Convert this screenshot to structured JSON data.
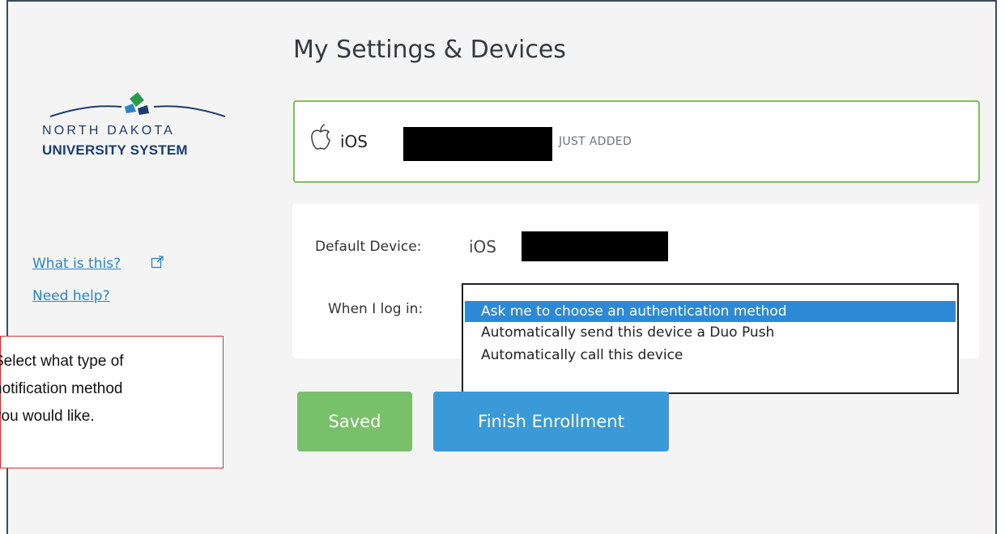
{
  "brand": {
    "line1": "NORTH DAKOTA",
    "line2": "UNIVERSITY SYSTEM"
  },
  "sidebar": {
    "what_is_this": "What is this?",
    "need_help": "Need help?"
  },
  "page": {
    "title": "My Settings & Devices"
  },
  "device": {
    "os": "iOS",
    "badge": "JUST ADDED"
  },
  "settings": {
    "default_device_label": "Default Device:",
    "default_device_os": "iOS",
    "login_label": "When I log in:",
    "options": [
      "Ask me to choose an authentication method",
      "Automatically send this device a Duo Push",
      "Automatically call this device"
    ]
  },
  "buttons": {
    "saved": "Saved",
    "finish": "Finish Enrollment"
  },
  "callout": {
    "line1": "Select what type of",
    "line2": "notification method",
    "line3": "you would like."
  },
  "colors": {
    "accent_blue": "#2d89d6",
    "success_green": "#79c06b",
    "card_border_green": "#7dc05a",
    "callout_border_red": "#d9302f"
  }
}
